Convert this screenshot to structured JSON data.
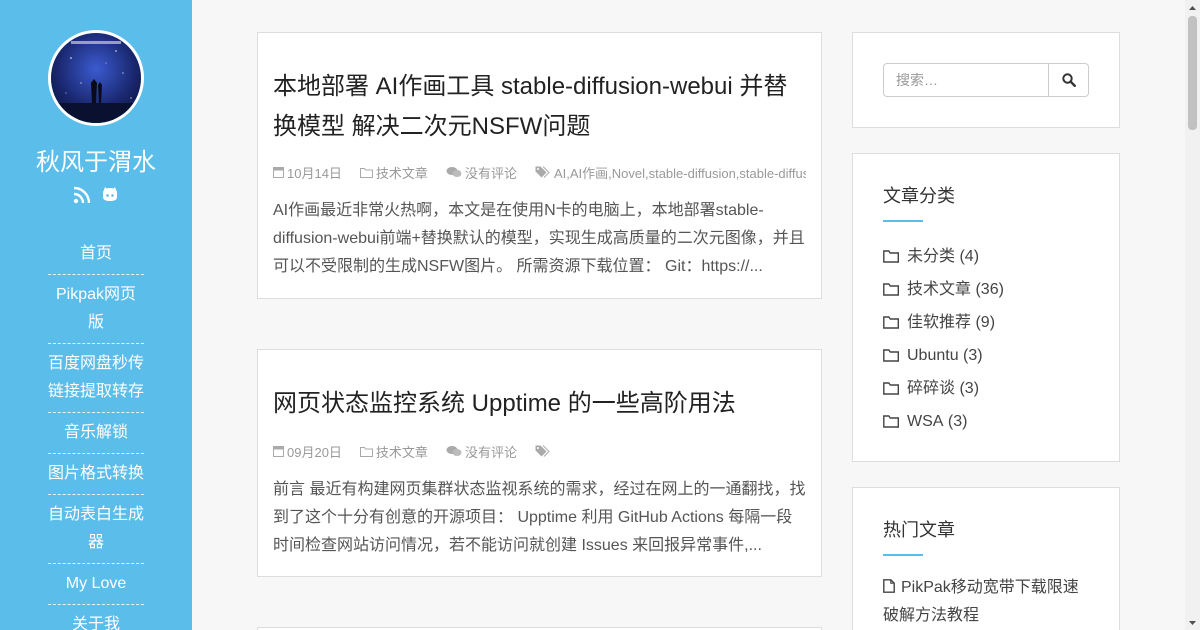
{
  "sidebar": {
    "site_title": "秋风于渭水",
    "nav": [
      "首页",
      "Pikpak网页版",
      "百度网盘秒传链接提取转存",
      "音乐解锁",
      "图片格式转换",
      "自动表白生成器",
      "My Love",
      "关于我"
    ],
    "social_icons": [
      "rss-icon",
      "github-icon"
    ]
  },
  "posts": [
    {
      "title": "本地部署 AI作画工具 stable-diffusion-webui 并替换模型 解决二次元NSFW问题",
      "date": "10月14日",
      "category": "技术文章",
      "comments": "没有评论",
      "tags": "AI,AI作画,Novel,stable-diffusion,stable-diffusion-webui",
      "excerpt": "AI作画最近非常火热啊，本文是在使用N卡的电脑上，本地部署stable-diffusion-webui前端+替换默认的模型，实现生成高质量的二次元图像，并且可以不受限制的生成NSFW图片。 所需资源下载位置： Git：https://..."
    },
    {
      "title": "网页状态监控系统 Upptime 的一些高阶用法",
      "date": "09月20日",
      "category": "技术文章",
      "comments": "没有评论",
      "tags": "",
      "excerpt": "前言 最近有构建网页集群状态监视系统的需求，经过在网上的一通翻找，找到了这个十分有创意的开源项目： Upptime 利用 GitHub Actions 每隔一段时间检查网站访问情况，若不能访问就创建 Issues 来回报异常事件,..."
    }
  ],
  "search": {
    "placeholder": "搜索…"
  },
  "categories_widget": {
    "title": "文章分类",
    "items": [
      {
        "name": "未分类",
        "count": "(4)"
      },
      {
        "name": "技术文章",
        "count": "(36)"
      },
      {
        "name": "佳软推荐",
        "count": "(9)"
      },
      {
        "name": "Ubuntu",
        "count": "(3)"
      },
      {
        "name": "碎碎谈",
        "count": "(3)"
      },
      {
        "name": "WSA",
        "count": "(3)"
      }
    ]
  },
  "hot_widget": {
    "title": "热门文章",
    "items": [
      "PikPak移动宽带下载限速破解方法教程"
    ]
  },
  "colors": {
    "accent": "#5bbde9"
  }
}
